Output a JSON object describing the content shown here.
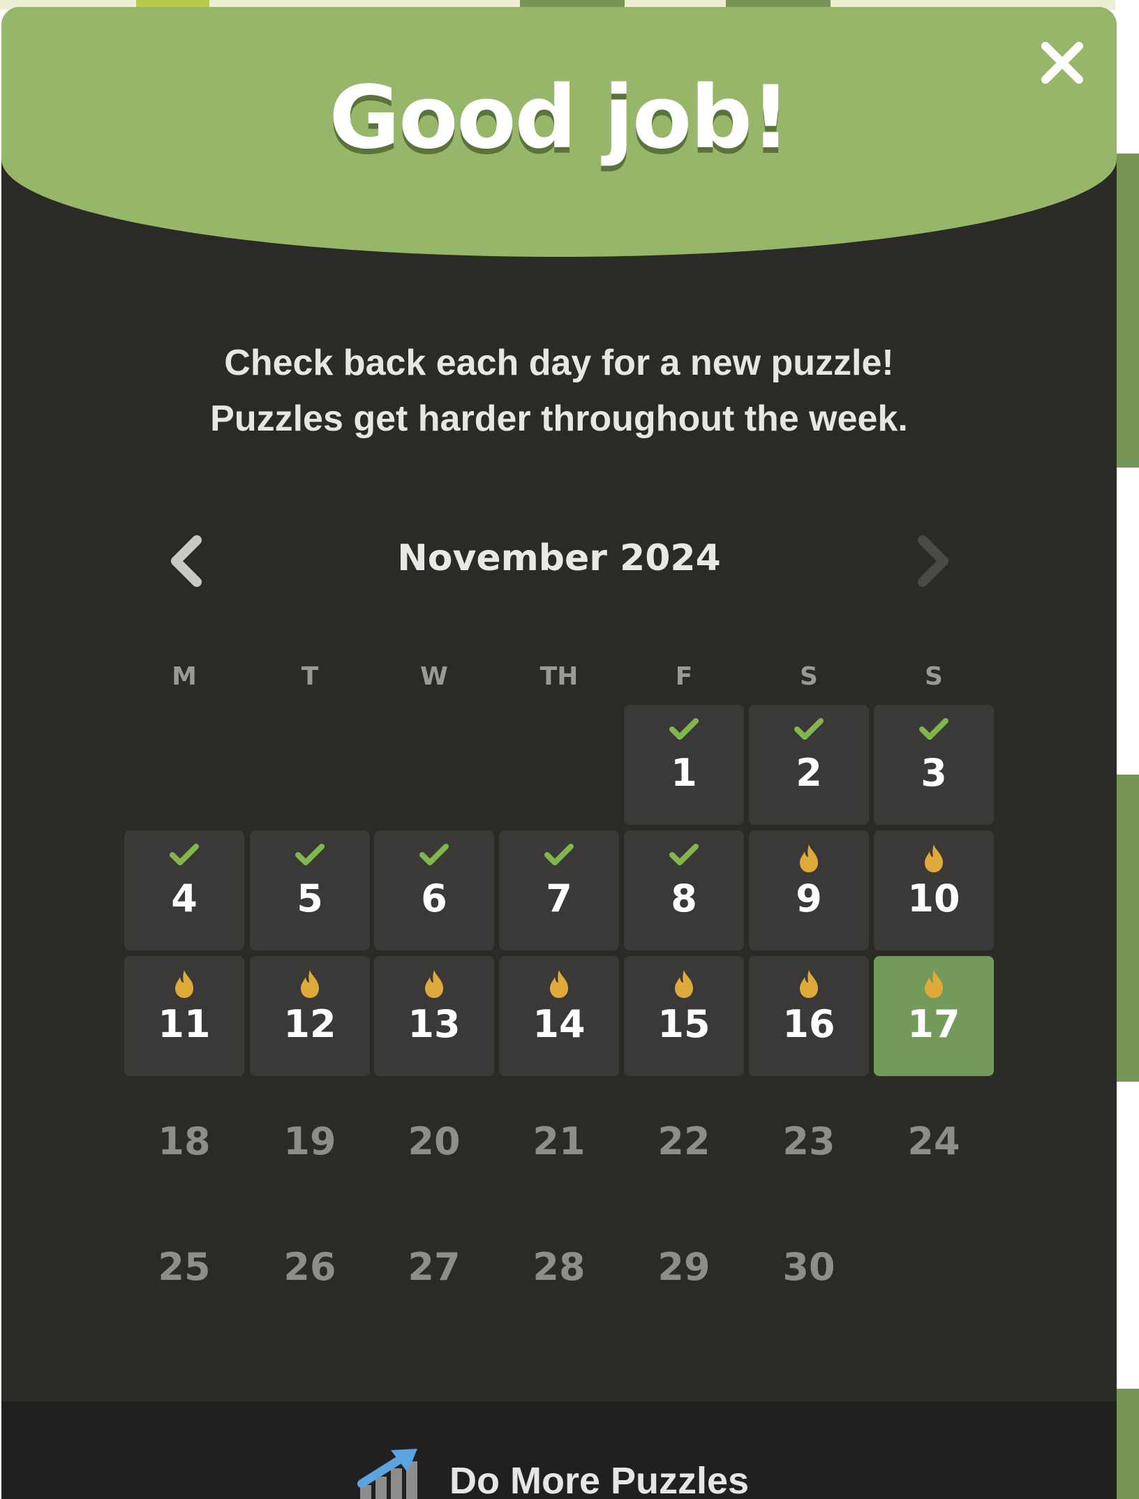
{
  "modal": {
    "title": "Good job!",
    "subtitle_line1": "Check back each day for a new puzzle!",
    "subtitle_line2": "Puzzles get harder throughout the week.",
    "close_icon": "close-icon"
  },
  "calendar": {
    "month_label": "November 2024",
    "prev_icon": "chevron-left-icon",
    "next_icon": "chevron-right-icon",
    "weekdays": [
      "M",
      "T",
      "W",
      "TH",
      "F",
      "S",
      "S"
    ],
    "days": [
      {
        "num": "1",
        "status": "solved"
      },
      {
        "num": "2",
        "status": "solved"
      },
      {
        "num": "3",
        "status": "solved"
      },
      {
        "num": "4",
        "status": "solved"
      },
      {
        "num": "5",
        "status": "solved"
      },
      {
        "num": "6",
        "status": "solved"
      },
      {
        "num": "7",
        "status": "solved"
      },
      {
        "num": "8",
        "status": "solved"
      },
      {
        "num": "9",
        "status": "streak"
      },
      {
        "num": "10",
        "status": "streak"
      },
      {
        "num": "11",
        "status": "streak"
      },
      {
        "num": "12",
        "status": "streak"
      },
      {
        "num": "13",
        "status": "streak"
      },
      {
        "num": "14",
        "status": "streak"
      },
      {
        "num": "15",
        "status": "streak"
      },
      {
        "num": "16",
        "status": "streak"
      },
      {
        "num": "17",
        "status": "today"
      },
      {
        "num": "18",
        "status": "future"
      },
      {
        "num": "19",
        "status": "future"
      },
      {
        "num": "20",
        "status": "future"
      },
      {
        "num": "21",
        "status": "future"
      },
      {
        "num": "22",
        "status": "future"
      },
      {
        "num": "23",
        "status": "future"
      },
      {
        "num": "24",
        "status": "future"
      },
      {
        "num": "25",
        "status": "future"
      },
      {
        "num": "26",
        "status": "future"
      },
      {
        "num": "27",
        "status": "future"
      },
      {
        "num": "28",
        "status": "future"
      },
      {
        "num": "29",
        "status": "future"
      },
      {
        "num": "30",
        "status": "future"
      }
    ]
  },
  "footer": {
    "button_label": "Do More Puzzles",
    "icon": "chart-arrow-icon"
  },
  "colors": {
    "header_green": "#96b769",
    "today_green": "#739a5b",
    "check_green": "#81b64c",
    "flame_gold": "#e0a93c",
    "panel_dark": "#2b2a27",
    "cell_dark": "#3a3937"
  }
}
